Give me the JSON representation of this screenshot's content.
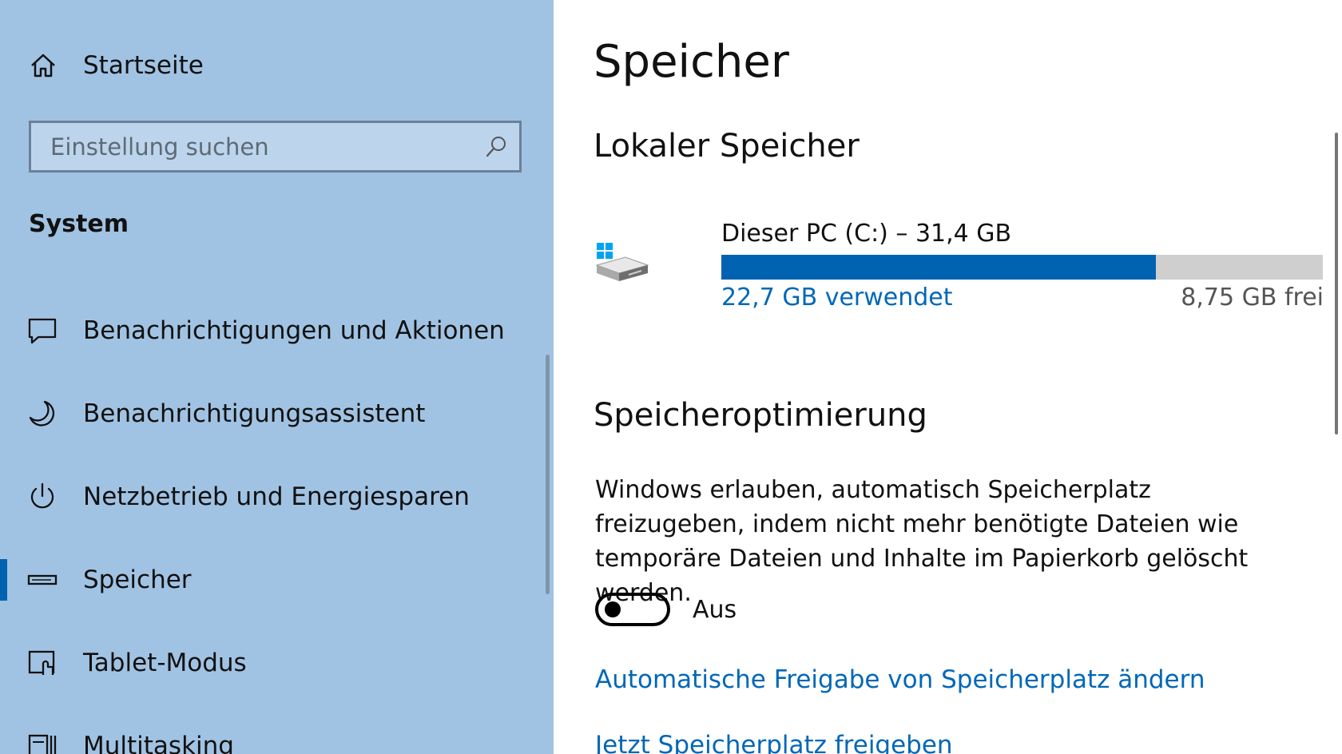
{
  "sidebar": {
    "home_label": "Startseite",
    "search_placeholder": "Einstellung suchen",
    "section_title": "System",
    "items": [
      {
        "label": "Benachrichtigungen und Aktionen",
        "icon": "message-icon",
        "active": false
      },
      {
        "label": "Benachrichtigungsassistent",
        "icon": "moon-icon",
        "active": false
      },
      {
        "label": "Netzbetrieb und Energiesparen",
        "icon": "power-icon",
        "active": false
      },
      {
        "label": "Speicher",
        "icon": "storage-icon",
        "active": true
      },
      {
        "label": "Tablet-Modus",
        "icon": "tablet-mode-icon",
        "active": false
      },
      {
        "label": "Multitasking",
        "icon": "multitasking-icon",
        "active": false
      }
    ]
  },
  "main": {
    "title": "Speicher",
    "local_storage": {
      "heading": "Lokaler Speicher",
      "drive_name": "Dieser PC (C:) – 31,4 GB",
      "used_label": "22,7 GB verwendet",
      "free_label": "8,75 GB frei",
      "used_fraction": 0.723
    },
    "optimization": {
      "heading": "Speicheroptimierung",
      "description": "Windows erlauben, automatisch Speicherplatz freizugeben, indem nicht mehr benötigte Dateien wie temporäre Dateien und Inhalte im Papierkorb gelöscht werden.",
      "toggle_state": "Aus",
      "link_change": "Automatische Freigabe von Speicherplatz ändern",
      "link_free_now": "Jetzt Speicherplatz freigeben"
    }
  },
  "colors": {
    "sidebar_bg": "#a1c3e3",
    "accent": "#0063b1",
    "link": "#0067b8",
    "bar_empty": "#cfcfcf"
  }
}
